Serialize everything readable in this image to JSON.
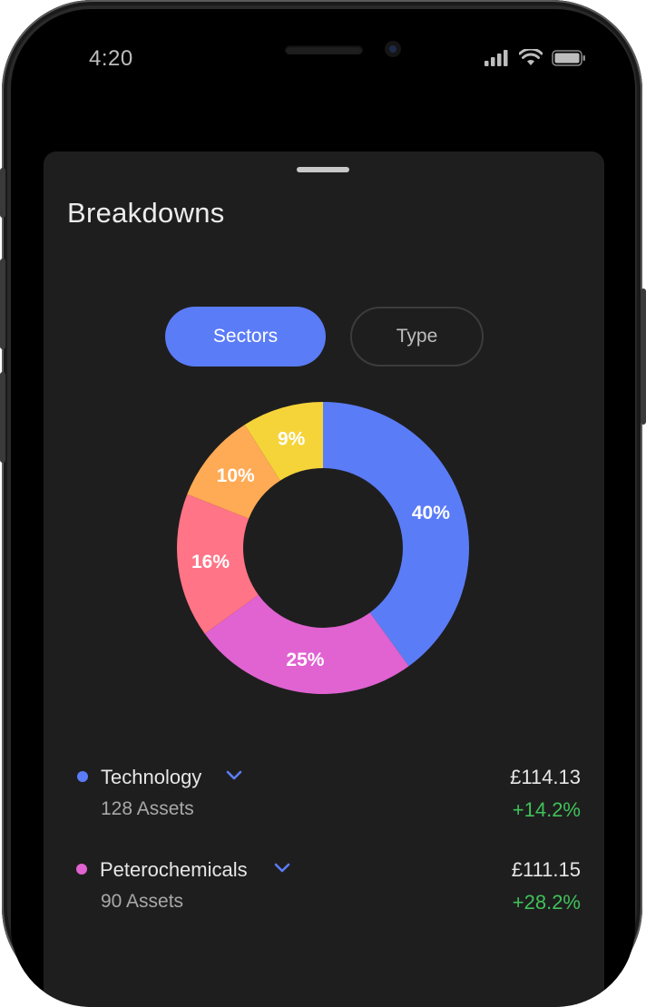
{
  "status_bar": {
    "time": "4:20",
    "icons": [
      "cellular-signal-icon",
      "wifi-icon",
      "battery-icon"
    ]
  },
  "sheet": {
    "title": "Breakdowns",
    "tabs": [
      {
        "label": "Sectors",
        "selected": true
      },
      {
        "label": "Type",
        "selected": false
      }
    ]
  },
  "chart_data": {
    "type": "pie",
    "style": "donut",
    "slices": [
      {
        "label": "40%",
        "value": 40,
        "color": "#5b7cf7"
      },
      {
        "label": "25%",
        "value": 25,
        "color": "#e063d1"
      },
      {
        "label": "16%",
        "value": 16,
        "color": "#ff7486"
      },
      {
        "label": "10%",
        "value": 10,
        "color": "#ffaa55"
      },
      {
        "label": "9%",
        "value": 9,
        "color": "#f5d43a"
      }
    ]
  },
  "breakdown_list": [
    {
      "name": "Technology",
      "assets": "128 Assets",
      "amount": "£114.13",
      "change": "+14.2%",
      "dot_color": "#5b7cf7"
    },
    {
      "name": "Peterochemicals",
      "assets": "90 Assets",
      "amount": "£111.15",
      "change": "+28.2%",
      "dot_color": "#e063d1"
    }
  ],
  "colors": {
    "accent": "#5b7cf7",
    "positive": "#3fc15a",
    "sheet_background": "#1e1e1e"
  }
}
